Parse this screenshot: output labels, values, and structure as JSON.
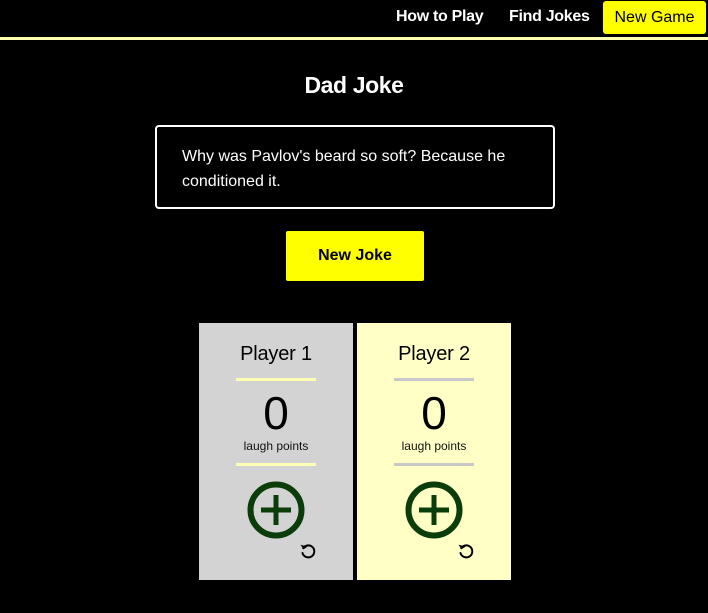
{
  "nav": {
    "how_to_play": "How to Play",
    "find_jokes": "Find Jokes",
    "new_game": "New Game"
  },
  "main": {
    "title": "Dad Joke",
    "joke_text": "Why was Pavlov's beard so soft? Because he conditioned it.",
    "new_joke_label": "New Joke"
  },
  "players": [
    {
      "name": "Player 1",
      "score": "0",
      "score_label": "laugh points"
    },
    {
      "name": "Player 2",
      "score": "0",
      "score_label": "laugh points"
    }
  ],
  "colors": {
    "accent": "#ffff00",
    "background": "#000000",
    "player1_card": "#d3d3d3",
    "player2_card": "#ffffc6",
    "plus_icon": "#0a3d0a"
  },
  "icons": {
    "add_point": "plus-circle-icon",
    "reset_score": "undo-icon"
  }
}
